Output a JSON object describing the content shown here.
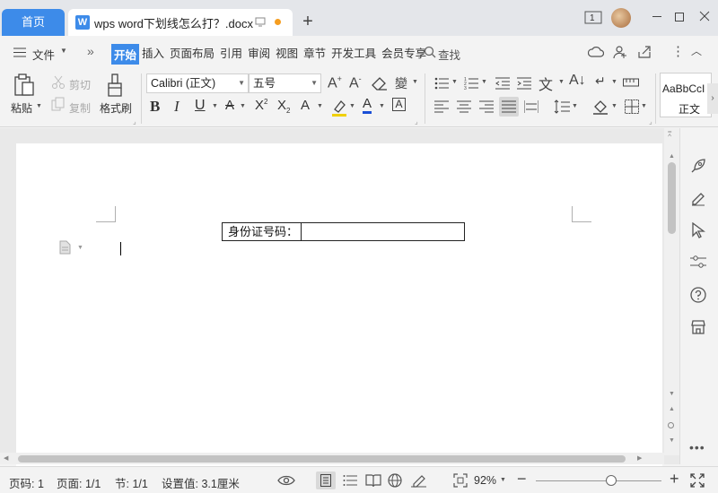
{
  "tabs": {
    "home": "首页",
    "document": "wps word下划线怎么打？.docx"
  },
  "menu": {
    "file": "文件",
    "items": [
      "开始",
      "插入",
      "页面布局",
      "引用",
      "审阅",
      "视图",
      "章节",
      "开发工具",
      "会员专享"
    ],
    "active": "开始",
    "search": "查找"
  },
  "ribbon": {
    "paste": "粘贴",
    "cut": "剪切",
    "copy": "复制",
    "format_painter": "格式刷",
    "font_name": "Calibri (正文)",
    "font_size": "五号",
    "style_preview": "AaBbCcI",
    "style_name": "正文"
  },
  "document": {
    "field_label": "身份证号码：",
    "field_value": ""
  },
  "status": {
    "page": "页码: 1",
    "pages": "页面: 1/1",
    "section": "节: 1/1",
    "setting": "设置值: 3.1厘米",
    "zoom": "92%"
  },
  "colors": {
    "accent": "#3d8be9",
    "font_color_bar": "#1a4fd6",
    "highlight_bar": "#f0d000",
    "unsaved_dot": "#f59d1f"
  },
  "zoom_slider_level": 0.6
}
